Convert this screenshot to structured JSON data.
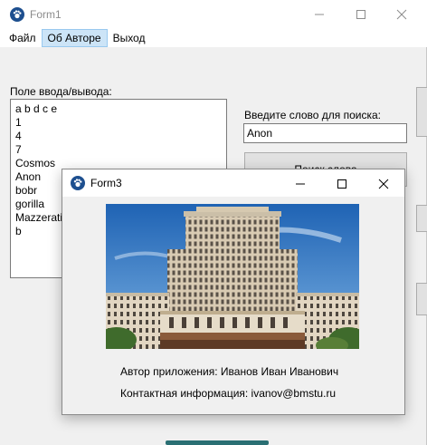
{
  "form1": {
    "title": "Form1",
    "menu": [
      "Файл",
      "Об Авторе",
      "Выход"
    ],
    "io_label": "Поле ввода/вывода:",
    "io_lines": [
      "a b d c e",
      "1",
      "4",
      "7",
      "Cosmos",
      "Anon",
      "bobr",
      "gorilla",
      "Mazzerati",
      "b"
    ],
    "search_label": "Введите слово для поиска:",
    "search_value": "Anon",
    "search_button": "Поиск слова"
  },
  "form3": {
    "title": "Form3",
    "author": "Автор приложения: Иванов Иван Иванович",
    "contact": "Контактная информация: ivanov@bmstu.ru"
  },
  "colors": {
    "window_bg": "#f0f0f0",
    "icon_blue": "#1d4f8f",
    "menu_highlight": "#cce4f7"
  },
  "icons": [
    "app-icon",
    "minimize-icon",
    "maximize-icon",
    "close-icon"
  ]
}
